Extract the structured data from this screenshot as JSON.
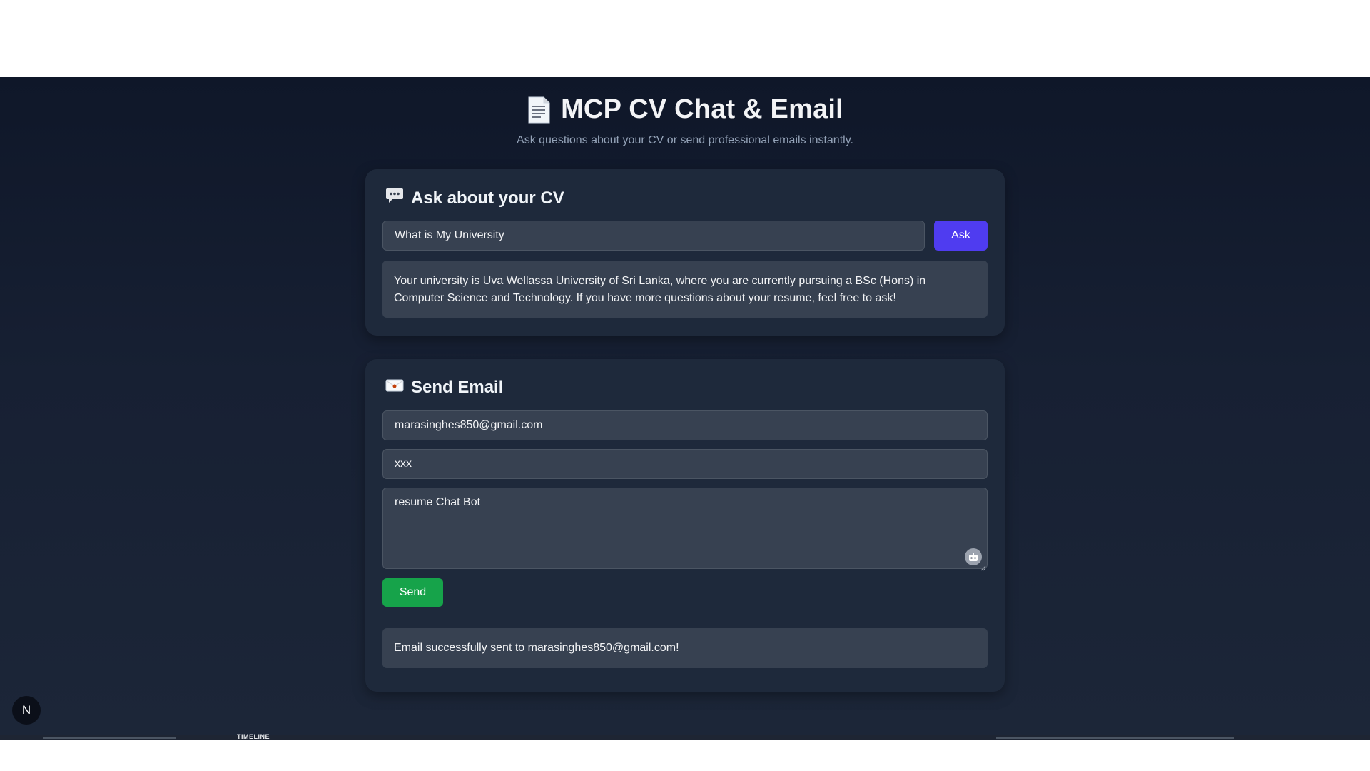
{
  "header": {
    "title": "MCP CV Chat & Email",
    "subtitle": "Ask questions about your CV or send professional emails instantly."
  },
  "cv_card": {
    "title": "Ask about your CV",
    "question_value": "What is My University",
    "ask_label": "Ask",
    "answer": "Your university is Uva Wellassa University of Sri Lanka, where you are currently pursuing a BSc (Hons) in Computer Science and Technology. If you have more questions about your resume, feel free to ask!"
  },
  "email_card": {
    "title": "Send Email",
    "to_value": "marasinghes850@gmail.com",
    "subject_value": "xxx",
    "body_value": "resume Chat Bot",
    "send_label": "Send",
    "status": "Email successfully sent to marasinghes850@gmail.com!"
  },
  "corner_badge": {
    "letter": "N"
  },
  "taskbar": {
    "label": "TIMELINE"
  },
  "icons": {
    "title": "document-icon",
    "cv_card": "speech-bubble-icon",
    "email_card": "envelope-icon",
    "textarea": "bot-icon"
  },
  "colors": {
    "background": "#172033",
    "card": "#1e293b",
    "field": "#374151",
    "ask_button": "#4f3cf0",
    "send_button": "#16a34a"
  }
}
